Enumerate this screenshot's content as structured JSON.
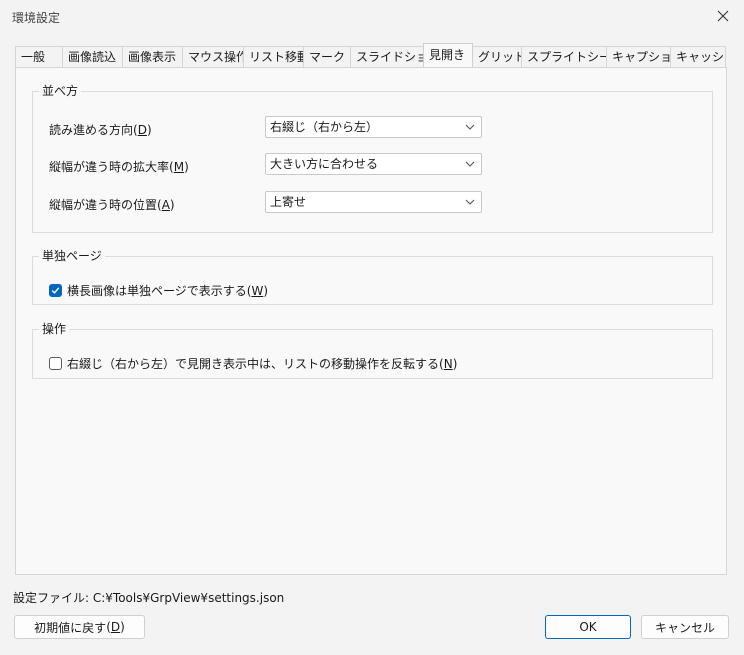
{
  "window": {
    "title": "環境設定",
    "close_icon": "close-icon"
  },
  "tabs": [
    {
      "label": "一般",
      "active": false
    },
    {
      "label": "画像読込",
      "active": false
    },
    {
      "label": "画像表示",
      "active": false
    },
    {
      "label": "マウス操作",
      "active": false
    },
    {
      "label": "リスト移動",
      "active": false
    },
    {
      "label": "マーク",
      "active": false
    },
    {
      "label": "スライドショー",
      "active": false
    },
    {
      "label": "見開き",
      "active": true
    },
    {
      "label": "グリッド",
      "active": false
    },
    {
      "label": "スプライトシート",
      "active": false
    },
    {
      "label": "キャプション",
      "active": false
    },
    {
      "label": "キャッシュ",
      "active": false
    }
  ],
  "order_group": {
    "title": "並べ方",
    "rows": [
      {
        "label": "読み進める方向",
        "key": "D",
        "value": "右綴じ（右から左）"
      },
      {
        "label": "縦幅が違う時の拡大率",
        "key": "M",
        "value": "大きい方に合わせる"
      },
      {
        "label": "縦幅が違う時の位置",
        "key": "A",
        "value": "上寄せ"
      }
    ]
  },
  "single_group": {
    "title": "単独ページ",
    "checkbox_label": "横長画像は単独ページで表示する",
    "checkbox_key": "W",
    "checked": true
  },
  "operation_group": {
    "title": "操作",
    "checkbox_label": "右綴じ（右から左）で見開き表示中は、リストの移動操作を反転する",
    "checkbox_key": "N",
    "checked": false
  },
  "footer": {
    "settings_file_label": "設定ファイル: C:¥Tools¥GrpView¥settings.json",
    "reset_label": "初期値に戻す",
    "reset_key": "D",
    "ok_label": "OK",
    "cancel_label": "キャンセル"
  },
  "colors": {
    "accent": "#0067c0",
    "background": "#f3f3f3",
    "panel": "#f9f9f9"
  }
}
